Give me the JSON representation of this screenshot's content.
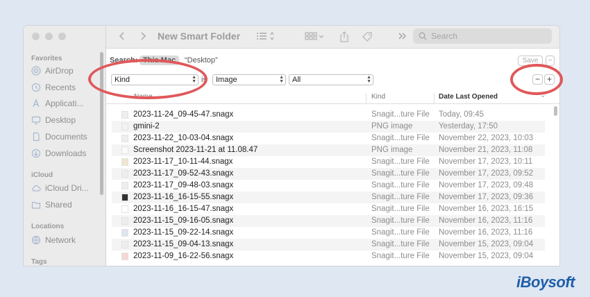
{
  "window": {
    "title": "New Smart Folder",
    "search_placeholder": "Search"
  },
  "sidebar": {
    "sections": [
      {
        "label": "Favorites",
        "items": [
          {
            "label": "AirDrop",
            "icon": "airdrop-icon"
          },
          {
            "label": "Recents",
            "icon": "clock-icon"
          },
          {
            "label": "Applicati...",
            "icon": "applications-icon"
          },
          {
            "label": "Desktop",
            "icon": "desktop-icon"
          },
          {
            "label": "Documents",
            "icon": "document-icon"
          },
          {
            "label": "Downloads",
            "icon": "download-icon"
          }
        ]
      },
      {
        "label": "iCloud",
        "items": [
          {
            "label": "iCloud Dri...",
            "icon": "cloud-icon"
          },
          {
            "label": "Shared",
            "icon": "shared-folder-icon"
          }
        ]
      },
      {
        "label": "Locations",
        "items": [
          {
            "label": "Network",
            "icon": "network-icon"
          }
        ]
      },
      {
        "label": "Tags",
        "items": []
      }
    ]
  },
  "search_scope": {
    "prefix": "Search:",
    "this_mac": "This Mac",
    "desktop": "“Desktop”",
    "save": "Save",
    "remove": "−"
  },
  "criteria": {
    "attribute": "Kind",
    "operator": "is",
    "value": "Image",
    "filter": "All",
    "remove": "−",
    "add": "+"
  },
  "columns": {
    "name": "Name",
    "kind": "Kind",
    "date": "Date Last Opened"
  },
  "rows": [
    {
      "name": "2023-11-24_09-45-47.snagx",
      "kind": "Snagit...ture File",
      "date": "Today, 09:45"
    },
    {
      "name": "gmini-2",
      "kind": "PNG image",
      "date": "Yesterday, 17:50"
    },
    {
      "name": "2023-11-22_10-03-04.snagx",
      "kind": "Snagit...ture File",
      "date": "November 22, 2023, 10:03"
    },
    {
      "name": "Screenshot 2023-11-21 at 11.08.47",
      "kind": "PNG image",
      "date": "November 21, 2023, 11:08"
    },
    {
      "name": "2023-11-17_10-11-44.snagx",
      "kind": "Snagit...ture File",
      "date": "November 17, 2023, 10:11"
    },
    {
      "name": "2023-11-17_09-52-43.snagx",
      "kind": "Snagit...ture File",
      "date": "November 17, 2023, 09:52"
    },
    {
      "name": "2023-11-17_09-48-03.snagx",
      "kind": "Snagit...ture File",
      "date": "November 17, 2023, 09:48"
    },
    {
      "name": "2023-11-16_16-15-55.snagx",
      "kind": "Snagit...ture File",
      "date": "November 17, 2023, 09:36"
    },
    {
      "name": "2023-11-16_16-15-47.snagx",
      "kind": "Snagit...ture File",
      "date": "November 16, 2023, 16:15"
    },
    {
      "name": "2023-11-15_09-16-05.snagx",
      "kind": "Snagit...ture File",
      "date": "November 16, 2023, 11:16"
    },
    {
      "name": "2023-11-15_09-22-14.snagx",
      "kind": "Snagit...ture File",
      "date": "November 16, 2023, 11:16"
    },
    {
      "name": "2023-11-15_09-04-13.snagx",
      "kind": "Snagit...ture File",
      "date": "November 15, 2023, 09:04"
    },
    {
      "name": "2023-11-09_16-22-56.snagx",
      "kind": "Snagit...ture File",
      "date": "November 15, 2023, 09:04"
    }
  ],
  "brand": "iBoysoft",
  "colors": {
    "annotation_ring": "#e0585a",
    "brand": "#1f5fa8",
    "background": "#dfe7f3"
  }
}
